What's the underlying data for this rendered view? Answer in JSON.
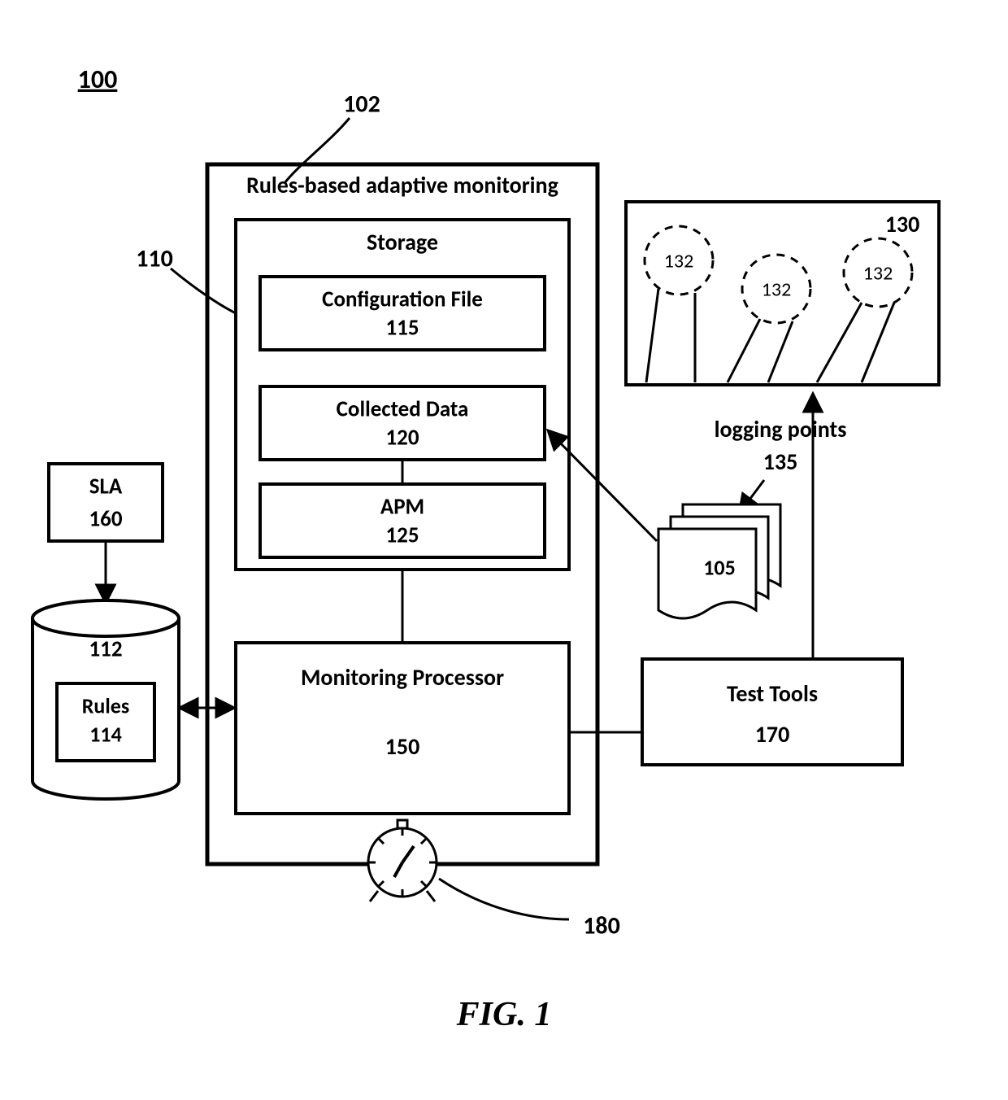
{
  "figure": {
    "id_label": "100",
    "caption": "FIG. 1",
    "callouts": {
      "system": "102",
      "storage": "110",
      "db": "112",
      "clock": "180",
      "cloud": "130",
      "cloud_nodes": "132",
      "logging_points_label": "logging points",
      "logging_points_num": "135",
      "docs": "105"
    },
    "boxes": {
      "system_title": "Rules-based adaptive monitoring",
      "storage": {
        "title": "Storage"
      },
      "config": {
        "title": "Configuration File",
        "num": "115"
      },
      "collected": {
        "title": "Collected Data",
        "num": "120"
      },
      "apm": {
        "title": "APM",
        "num": "125"
      },
      "sla": {
        "title": "SLA",
        "num": "160"
      },
      "rules": {
        "title": "Rules",
        "num": "114"
      },
      "mon": {
        "title": "Monitoring Processor",
        "num": "150"
      },
      "tools": {
        "title": "Test Tools",
        "num": "170"
      }
    }
  }
}
